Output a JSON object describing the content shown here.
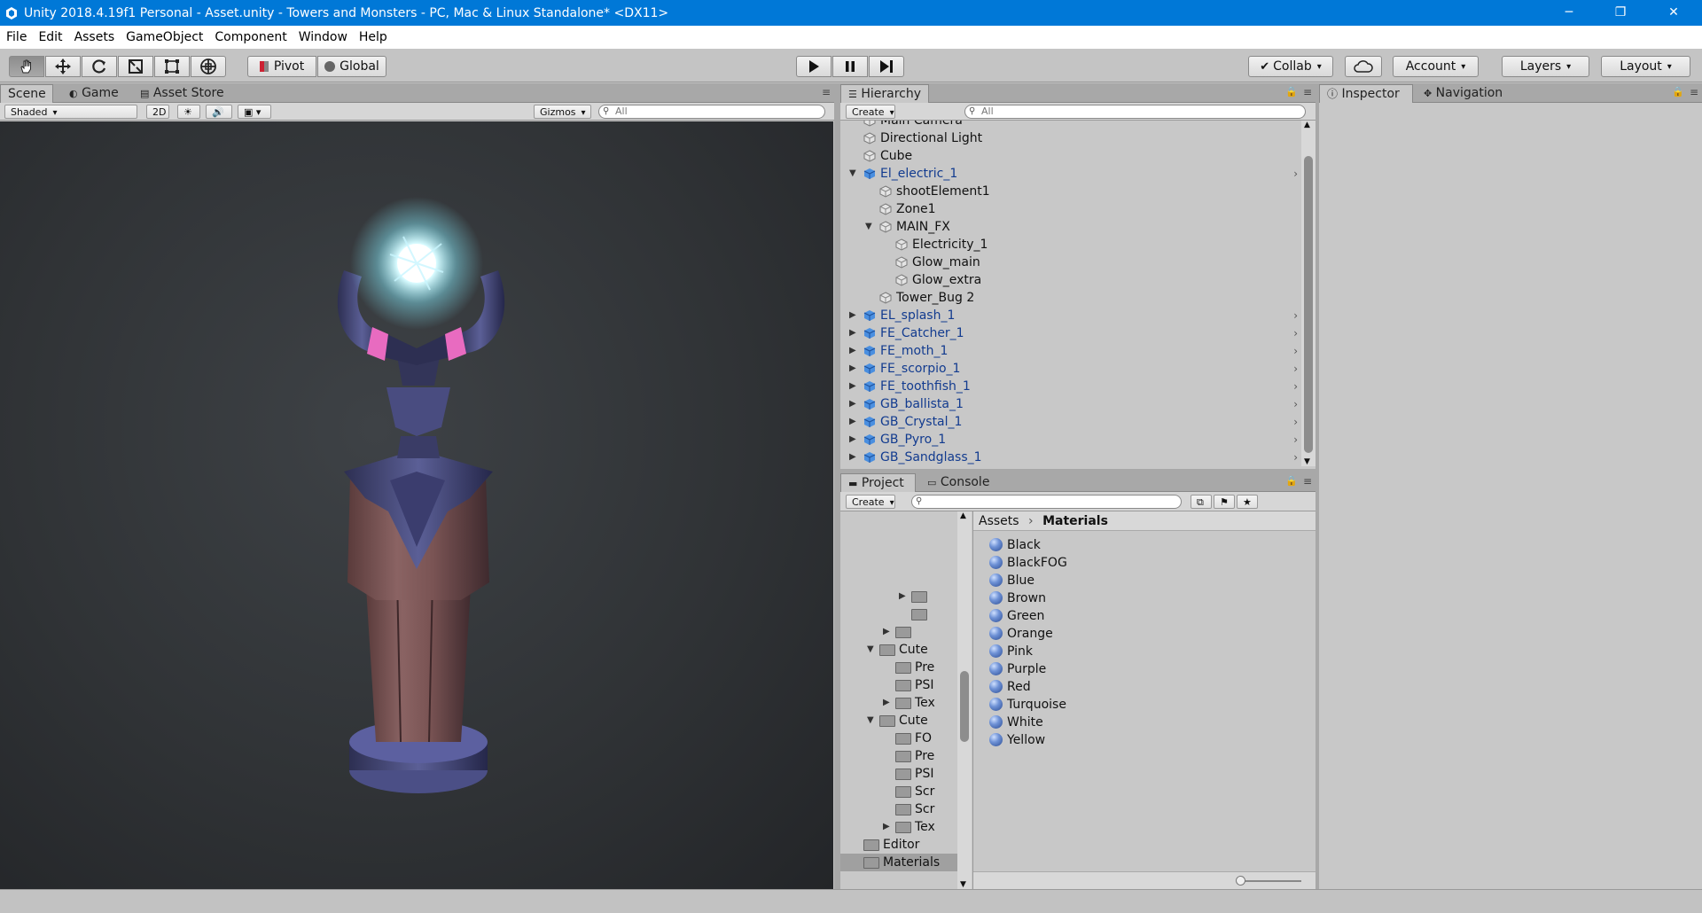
{
  "window": {
    "title": "Unity 2018.4.19f1 Personal - Asset.unity - Towers and Monsters - PC, Mac & Linux Standalone* <DX11>",
    "minimize": "─",
    "maximize": "❐",
    "close": "✕"
  },
  "menu": [
    "File",
    "Edit",
    "Assets",
    "GameObject",
    "Component",
    "Window",
    "Help"
  ],
  "toolbar": {
    "tools": [
      "hand-tool-icon",
      "move-tool-icon",
      "rotate-tool-icon",
      "scale-tool-icon",
      "rect-tool-icon",
      "transform-tool-icon"
    ],
    "pivot": "Pivot",
    "global": "Global",
    "collab": "Collab",
    "account": "Account",
    "layers": "Layers",
    "layout": "Layout"
  },
  "scene_panel": {
    "tabs": [
      "Scene",
      "Game",
      "Asset Store"
    ],
    "shading": "Shaded",
    "mode_2d": "2D",
    "gizmos": "Gizmos",
    "search_placeholder": "All"
  },
  "hierarchy": {
    "tab": "Hierarchy",
    "create": "Create",
    "search_placeholder": "All",
    "items": [
      {
        "label": "Main Camera",
        "indent": 0,
        "prefab": false,
        "foldout": "",
        "chevron": false
      },
      {
        "label": "Directional Light",
        "indent": 0,
        "prefab": false,
        "foldout": "",
        "chevron": false
      },
      {
        "label": "Cube",
        "indent": 0,
        "prefab": false,
        "foldout": "",
        "chevron": false
      },
      {
        "label": "El_electric_1",
        "indent": 0,
        "prefab": true,
        "foldout": "▼",
        "chevron": true
      },
      {
        "label": "shootElement1",
        "indent": 1,
        "prefab": false,
        "foldout": "",
        "chevron": false
      },
      {
        "label": "Zone1",
        "indent": 1,
        "prefab": false,
        "foldout": "",
        "chevron": false
      },
      {
        "label": "MAIN_FX",
        "indent": 1,
        "prefab": false,
        "foldout": "▼",
        "chevron": false
      },
      {
        "label": "Electricity_1",
        "indent": 2,
        "prefab": false,
        "foldout": "",
        "chevron": false
      },
      {
        "label": "Glow_main",
        "indent": 2,
        "prefab": false,
        "foldout": "",
        "chevron": false
      },
      {
        "label": "Glow_extra",
        "indent": 2,
        "prefab": false,
        "foldout": "",
        "chevron": false
      },
      {
        "label": "Tower_Bug 2",
        "indent": 1,
        "prefab": false,
        "foldout": "",
        "chevron": false
      },
      {
        "label": "EL_splash_1",
        "indent": 0,
        "prefab": true,
        "foldout": "▶",
        "chevron": true
      },
      {
        "label": "FE_Catcher_1",
        "indent": 0,
        "prefab": true,
        "foldout": "▶",
        "chevron": true
      },
      {
        "label": "FE_moth_1",
        "indent": 0,
        "prefab": true,
        "foldout": "▶",
        "chevron": true
      },
      {
        "label": "FE_scorpio_1",
        "indent": 0,
        "prefab": true,
        "foldout": "▶",
        "chevron": true
      },
      {
        "label": "FE_toothfish_1",
        "indent": 0,
        "prefab": true,
        "foldout": "▶",
        "chevron": true
      },
      {
        "label": "GB_ballista_1",
        "indent": 0,
        "prefab": true,
        "foldout": "▶",
        "chevron": true
      },
      {
        "label": "GB_Crystal_1",
        "indent": 0,
        "prefab": true,
        "foldout": "▶",
        "chevron": true
      },
      {
        "label": "GB_Pyro_1",
        "indent": 0,
        "prefab": true,
        "foldout": "▶",
        "chevron": true
      },
      {
        "label": "GB_Sandglass_1",
        "indent": 0,
        "prefab": true,
        "foldout": "▶",
        "chevron": true
      }
    ]
  },
  "project": {
    "tabs": [
      "Project",
      "Console"
    ],
    "create": "Create",
    "breadcrumb": [
      "Assets",
      "Materials"
    ],
    "tree": [
      {
        "label": "",
        "indent": 4,
        "foldout": "▶"
      },
      {
        "label": "",
        "indent": 4,
        "foldout": ""
      },
      {
        "label": "",
        "indent": 3,
        "foldout": "▶"
      },
      {
        "label": "Cute",
        "indent": 2,
        "foldout": "▼"
      },
      {
        "label": "Pre",
        "indent": 3,
        "foldout": ""
      },
      {
        "label": "PSI",
        "indent": 3,
        "foldout": ""
      },
      {
        "label": "Tex",
        "indent": 3,
        "foldout": "▶"
      },
      {
        "label": "Cute",
        "indent": 2,
        "foldout": "▼"
      },
      {
        "label": "FO",
        "indent": 3,
        "foldout": ""
      },
      {
        "label": "Pre",
        "indent": 3,
        "foldout": ""
      },
      {
        "label": "PSI",
        "indent": 3,
        "foldout": ""
      },
      {
        "label": "Scr",
        "indent": 3,
        "foldout": ""
      },
      {
        "label": "Scr",
        "indent": 3,
        "foldout": ""
      },
      {
        "label": "Tex",
        "indent": 3,
        "foldout": "▶"
      },
      {
        "label": "Editor",
        "indent": 1,
        "foldout": ""
      },
      {
        "label": "Materials",
        "indent": 1,
        "foldout": ""
      }
    ],
    "materials": [
      "Black",
      "BlackFOG",
      "Blue",
      "Brown",
      "Green",
      "Orange",
      "Pink",
      "Purple",
      "Red",
      "Turquoise",
      "White",
      "Yellow"
    ]
  },
  "inspector": {
    "tabs": [
      "Inspector",
      "Navigation"
    ]
  },
  "colors": {
    "titlebar": "#0078d7",
    "prefab_text": "#123b8f",
    "selection": "#a0a0a0"
  }
}
